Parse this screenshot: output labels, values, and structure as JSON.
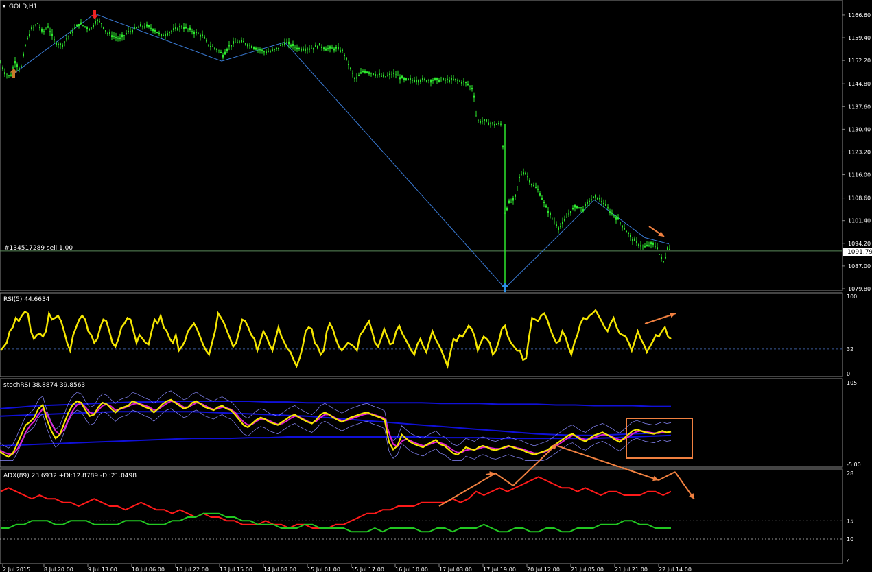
{
  "chart_data": [
    {
      "type": "line",
      "panel": "price",
      "title": "GOLD,H1",
      "order_label": "#134517289 sell 1.00",
      "current_price": "1091.79",
      "y_ticks": [
        "1166.60",
        "1159.40",
        "1152.20",
        "1144.80",
        "1137.60",
        "1130.40",
        "1123.20",
        "1116.00",
        "1108.60",
        "1101.40",
        "1094.20",
        "1087.00",
        "1079.80"
      ],
      "ylim": [
        1079.8,
        1170.5
      ],
      "price_points": [
        [
          0,
          1152
        ],
        [
          8,
          1148
        ],
        [
          15,
          1147
        ],
        [
          22,
          1152
        ],
        [
          30,
          1149
        ],
        [
          38,
          1158
        ],
        [
          46,
          1162
        ],
        [
          55,
          1164
        ],
        [
          62,
          1161
        ],
        [
          70,
          1163
        ],
        [
          80,
          1158
        ],
        [
          90,
          1157
        ],
        [
          100,
          1160
        ],
        [
          108,
          1162
        ],
        [
          116,
          1164
        ],
        [
          124,
          1163
        ],
        [
          132,
          1162
        ],
        [
          140,
          1165
        ],
        [
          148,
          1164
        ],
        [
          156,
          1161
        ],
        [
          165,
          1160
        ],
        [
          175,
          1159
        ],
        [
          185,
          1161
        ],
        [
          195,
          1162
        ],
        [
          205,
          1163
        ],
        [
          215,
          1163
        ],
        [
          225,
          1162
        ],
        [
          235,
          1160
        ],
        [
          245,
          1161
        ],
        [
          255,
          1162
        ],
        [
          265,
          1163
        ],
        [
          275,
          1162
        ],
        [
          285,
          1161
        ],
        [
          295,
          1160
        ],
        [
          305,
          1157
        ],
        [
          315,
          1156
        ],
        [
          325,
          1154
        ],
        [
          335,
          1157
        ],
        [
          345,
          1158
        ],
        [
          355,
          1158
        ],
        [
          365,
          1157
        ],
        [
          375,
          1156
        ],
        [
          385,
          1155
        ],
        [
          395,
          1155
        ],
        [
          405,
          1156
        ],
        [
          415,
          1158
        ],
        [
          425,
          1157
        ],
        [
          435,
          1156
        ],
        [
          445,
          1156
        ],
        [
          455,
          1156
        ],
        [
          465,
          1157
        ],
        [
          475,
          1156
        ],
        [
          490,
          1156
        ],
        [
          500,
          1155
        ],
        [
          510,
          1150
        ],
        [
          518,
          1146
        ],
        [
          530,
          1149
        ],
        [
          545,
          1148
        ],
        [
          560,
          1147
        ],
        [
          575,
          1148
        ],
        [
          590,
          1146
        ],
        [
          605,
          1146
        ],
        [
          620,
          1146
        ],
        [
          635,
          1146
        ],
        [
          650,
          1146
        ],
        [
          665,
          1146
        ],
        [
          680,
          1145
        ],
        [
          690,
          1143
        ],
        [
          695,
          1133
        ],
        [
          705,
          1133
        ],
        [
          720,
          1132
        ],
        [
          732,
          1132
        ],
        [
          736,
          1104
        ],
        [
          742,
          1107
        ],
        [
          750,
          1108
        ],
        [
          758,
          1116
        ],
        [
          765,
          1117
        ],
        [
          775,
          1113
        ],
        [
          785,
          1111
        ],
        [
          795,
          1106
        ],
        [
          805,
          1102
        ],
        [
          815,
          1099
        ],
        [
          822,
          1101
        ],
        [
          830,
          1104
        ],
        [
          840,
          1106
        ],
        [
          850,
          1105
        ],
        [
          860,
          1108
        ],
        [
          870,
          1109
        ],
        [
          880,
          1107
        ],
        [
          890,
          1104
        ],
        [
          900,
          1102
        ],
        [
          910,
          1099
        ],
        [
          920,
          1096
        ],
        [
          930,
          1094
        ],
        [
          940,
          1093
        ],
        [
          950,
          1094
        ],
        [
          958,
          1093
        ],
        [
          962,
          1090
        ],
        [
          968,
          1088
        ],
        [
          973,
          1093
        ],
        [
          978,
          1092
        ]
      ],
      "zigzag": [
        [
          20,
          1148
        ],
        [
          138,
          1167
        ],
        [
          323,
          1152
        ],
        [
          415,
          1158
        ],
        [
          736,
          1080
        ],
        [
          806,
          1095
        ],
        [
          866,
          1108
        ],
        [
          940,
          1096
        ],
        [
          975,
          1094
        ]
      ],
      "up_arrows": [
        [
          20,
          1148,
          "#c87a2a"
        ],
        [
          736,
          1080,
          "#2b8fe6"
        ]
      ],
      "down_arrows": [
        [
          138,
          1167,
          "#e22"
        ]
      ]
    },
    {
      "type": "line",
      "panel": "rsi",
      "title": "RSI(5) 44.6634",
      "y_ticks": [
        "100",
        "32",
        "0"
      ],
      "ylim": [
        0,
        100
      ],
      "level": 32,
      "values": [
        30,
        35,
        40,
        55,
        60,
        72,
        68,
        75,
        80,
        78,
        55,
        45,
        50,
        52,
        48,
        55,
        78,
        70,
        72,
        75,
        68,
        55,
        40,
        30,
        50,
        60,
        70,
        75,
        70,
        55,
        50,
        40,
        45,
        60,
        70,
        68,
        55,
        40,
        35,
        45,
        60,
        65,
        72,
        70,
        55,
        40,
        50,
        45,
        40,
        38,
        55,
        70,
        65,
        75,
        60,
        55,
        45,
        40,
        50,
        30,
        35,
        42,
        55,
        60,
        65,
        58,
        48,
        38,
        30,
        25,
        40,
        55,
        78,
        72,
        65,
        55,
        45,
        35,
        40,
        55,
        70,
        68,
        60,
        50,
        45,
        30,
        42,
        55,
        48,
        38,
        30,
        45,
        60,
        48,
        40,
        32,
        28,
        18,
        10,
        20,
        35,
        55,
        60,
        58,
        40,
        35,
        25,
        30,
        55,
        65,
        58,
        45,
        35,
        30,
        35,
        40,
        38,
        35,
        30,
        50,
        55,
        62,
        68,
        55,
        40,
        35,
        45,
        58,
        48,
        38,
        40,
        55,
        62,
        52,
        45,
        38,
        30,
        25,
        38,
        45,
        35,
        28,
        42,
        55,
        45,
        38,
        30,
        20,
        10,
        28,
        45,
        42,
        50,
        48,
        55,
        62,
        58,
        48,
        30,
        40,
        48,
        45,
        40,
        25,
        30,
        42,
        58,
        62,
        48,
        40,
        35,
        30,
        30,
        18,
        20,
        48,
        72,
        70,
        68,
        75,
        78,
        70,
        58,
        48,
        40,
        42,
        55,
        48,
        35,
        25,
        40,
        50,
        65,
        72,
        70,
        75,
        78,
        82,
        75,
        68,
        60,
        55,
        65,
        72,
        60,
        52,
        50,
        48,
        40,
        30,
        42,
        55,
        45,
        38,
        28,
        35,
        42,
        50,
        48,
        55,
        60,
        48,
        45
      ]
    },
    {
      "type": "line",
      "panel": "stochrsi",
      "title": "stochRSI 38.8874 39.8563",
      "y_ticks": [
        "105",
        "-5.00"
      ],
      "ylim": [
        -5,
        105
      ],
      "stoch_k": [
        12,
        8,
        5,
        10,
        22,
        35,
        48,
        52,
        58,
        70,
        75,
        55,
        40,
        30,
        35,
        50,
        65,
        75,
        80,
        78,
        68,
        60,
        62,
        72,
        78,
        76,
        70,
        65,
        70,
        72,
        74,
        80,
        78,
        75,
        72,
        70,
        65,
        70,
        76,
        80,
        82,
        78,
        74,
        70,
        72,
        78,
        80,
        76,
        72,
        70,
        68,
        72,
        74,
        70,
        68,
        62,
        55,
        48,
        45,
        50,
        55,
        58,
        56,
        52,
        50,
        48,
        52,
        56,
        60,
        62,
        58,
        55,
        52,
        50,
        55,
        62,
        65,
        62,
        58,
        55,
        52,
        55,
        58,
        60,
        62,
        64,
        65,
        62,
        60,
        58,
        55,
        25,
        15,
        20,
        35,
        30,
        25,
        22,
        20,
        18,
        22,
        25,
        28,
        22,
        20,
        15,
        10,
        8,
        12,
        18,
        16,
        14,
        18,
        20,
        18,
        15,
        14,
        16,
        18,
        20,
        18,
        16,
        15,
        12,
        10,
        8,
        10,
        12,
        14,
        18,
        22,
        26,
        30,
        34,
        36,
        32,
        28,
        26,
        30,
        34,
        36,
        38,
        35,
        32,
        28,
        25,
        30,
        35,
        40,
        42,
        40,
        38,
        37,
        36,
        38,
        40,
        38,
        39
      ],
      "stoch_d": [
        14,
        11,
        9,
        9,
        15,
        25,
        38,
        47,
        53,
        62,
        70,
        63,
        50,
        40,
        35,
        42,
        55,
        67,
        75,
        77,
        72,
        65,
        63,
        68,
        74,
        76,
        73,
        68,
        69,
        71,
        73,
        76,
        77,
        76,
        74,
        72,
        68,
        69,
        73,
        77,
        80,
        79,
        76,
        72,
        72,
        75,
        78,
        77,
        74,
        71,
        69,
        70,
        72,
        71,
        69,
        65,
        58,
        52,
        48,
        49,
        53,
        56,
        56,
        54,
        51,
        49,
        50,
        53,
        57,
        60,
        59,
        56,
        53,
        51,
        53,
        58,
        62,
        62,
        59,
        56,
        54,
        54,
        56,
        58,
        60,
        62,
        63,
        63,
        61,
        59,
        57,
        38,
        22,
        19,
        26,
        29,
        27,
        24,
        22,
        20,
        21,
        23,
        25,
        24,
        22,
        18,
        14,
        11,
        11,
        14,
        15,
        15,
        16,
        18,
        18,
        17,
        16,
        16,
        17,
        19,
        19,
        17,
        16,
        14,
        12,
        10,
        10,
        11,
        13,
        16,
        19,
        23,
        27,
        31,
        34,
        33,
        30,
        28,
        29,
        31,
        33,
        35,
        35,
        33,
        30,
        28,
        29,
        32,
        36,
        39,
        40,
        39,
        38,
        37,
        37,
        38,
        38,
        39
      ],
      "bands_upper": [
        70,
        72,
        74,
        75,
        76,
        77,
        78,
        79,
        79,
        80,
        80,
        80,
        80,
        80,
        79,
        79,
        78,
        78,
        78,
        78,
        78,
        78,
        78,
        77,
        77,
        77,
        76,
        76,
        76,
        75,
        75,
        74,
        74,
        74,
        73,
        73
      ],
      "bands_mid": [
        60,
        61,
        62,
        63,
        64,
        65,
        66,
        66,
        66,
        66,
        66,
        65,
        64,
        63,
        62,
        61,
        60,
        58,
        56,
        54,
        52,
        50,
        48,
        46,
        44,
        42,
        40,
        38,
        36,
        35,
        34,
        34,
        35,
        36,
        37,
        38
      ],
      "bands_lower": [
        20,
        21,
        22,
        23,
        24,
        25,
        26,
        27,
        28,
        29,
        30,
        30,
        30,
        31,
        31,
        32,
        32,
        32,
        32,
        32,
        32,
        32,
        32,
        31,
        31,
        31,
        30,
        30,
        30,
        30,
        30,
        30,
        31,
        32,
        33,
        34
      ]
    },
    {
      "type": "line",
      "panel": "adx",
      "title": "ADX(89) 23.6932 +DI:12.8789 -DI:21.0498",
      "y_ticks": [
        "28",
        "15",
        "10",
        "4"
      ],
      "ylim": [
        4,
        28
      ],
      "levels": [
        15,
        10
      ],
      "series": [
        {
          "color": "#ff1a1a",
          "values": [
            23,
            24,
            23,
            22,
            21,
            22,
            21,
            21,
            20,
            20,
            19,
            20,
            21,
            20,
            19,
            19,
            18,
            19,
            20,
            19,
            18,
            18,
            17,
            18,
            17,
            16,
            17,
            16,
            16,
            15,
            15,
            14,
            14,
            14,
            15,
            14,
            14,
            13,
            14,
            14,
            13,
            13,
            13,
            14,
            14,
            15,
            16,
            17,
            17,
            18,
            18,
            19,
            19,
            19,
            20,
            20,
            20,
            20,
            21,
            20,
            21,
            23,
            22,
            23,
            24,
            23,
            24,
            25,
            26,
            27,
            26,
            25,
            24,
            24,
            23,
            24,
            23,
            22,
            23,
            23,
            22,
            22,
            22,
            23,
            23,
            22,
            23
          ]
        },
        {
          "color": "#22c822",
          "values": [
            13,
            13,
            14,
            14,
            15,
            15,
            15,
            14,
            14,
            15,
            15,
            15,
            14,
            14,
            14,
            14,
            15,
            15,
            15,
            14,
            14,
            14,
            15,
            15,
            16,
            16,
            17,
            17,
            17,
            16,
            16,
            15,
            15,
            14,
            14,
            14,
            13,
            13,
            13,
            14,
            14,
            13,
            13,
            13,
            13,
            12,
            12,
            12,
            13,
            12,
            13,
            13,
            13,
            13,
            12,
            12,
            13,
            13,
            12,
            13,
            13,
            13,
            14,
            13,
            12,
            12,
            13,
            13,
            12,
            12,
            13,
            13,
            12,
            12,
            13,
            13,
            13,
            14,
            14,
            14,
            15,
            15,
            14,
            14,
            13,
            13,
            13
          ]
        }
      ]
    }
  ],
  "x_axis": [
    "2 Jul 2015",
    "8 Jul 20:00",
    "9 Jul 13:00",
    "10 Jul 06:00",
    "10 Jul 22:00",
    "13 Jul 15:00",
    "14 Jul 08:00",
    "15 Jul 01:00",
    "15 Jul 17:00",
    "16 Jul 10:00",
    "17 Jul 03:00",
    "17 Jul 19:00",
    "20 Jul 12:00",
    "21 Jul 05:00",
    "21 Jul 21:00",
    "22 Jul 14:00"
  ],
  "colors": {
    "background": "#000000",
    "candles": "#2ee82e",
    "zigzag": "#3a7bd5",
    "rsi": "#f5e600",
    "stoch_k": "#f5e600",
    "stoch_d": "#e020d0",
    "band": "#1010d8",
    "grid_level": "#3a5a9a",
    "annotation": "#f08040",
    "current_price_line": "#5a8a5a"
  }
}
